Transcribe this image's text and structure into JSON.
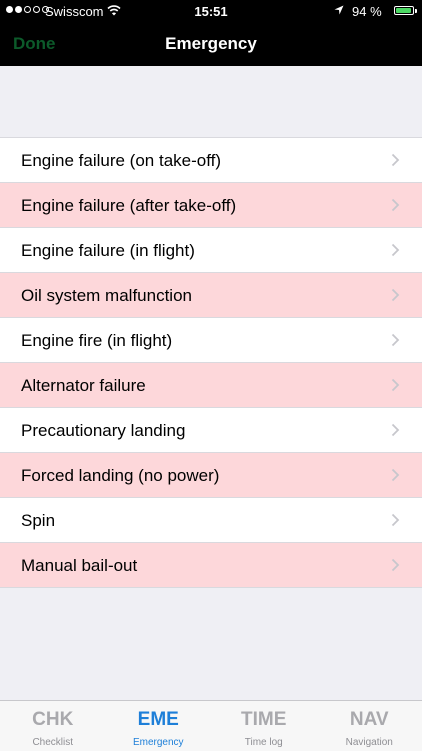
{
  "status_bar": {
    "carrier": "Swisscom",
    "time": "15:51",
    "battery_percent": "94 %",
    "battery_level": 0.94
  },
  "nav_bar": {
    "done_label": "Done",
    "title": "Emergency"
  },
  "items": [
    {
      "label": "Engine failure (on take-off)"
    },
    {
      "label": "Engine failure (after take-off)"
    },
    {
      "label": "Engine failure (in flight)"
    },
    {
      "label": "Oil system malfunction"
    },
    {
      "label": "Engine fire (in flight)"
    },
    {
      "label": "Alternator failure"
    },
    {
      "label": "Precautionary landing"
    },
    {
      "label": "Forced landing (no power)"
    },
    {
      "label": "Spin"
    },
    {
      "label": "Manual bail-out"
    }
  ],
  "tabs": [
    {
      "code": "CHK",
      "label": "Checklist"
    },
    {
      "code": "EME",
      "label": "Emergency",
      "active": true
    },
    {
      "code": "TIME",
      "label": "Time log"
    },
    {
      "code": "NAV",
      "label": "Navigation"
    }
  ],
  "colors": {
    "row_alternate": "#fdd7da",
    "tab_active": "#1e7fd8",
    "done_button": "#0c5a2a",
    "battery": "#4cd964"
  }
}
